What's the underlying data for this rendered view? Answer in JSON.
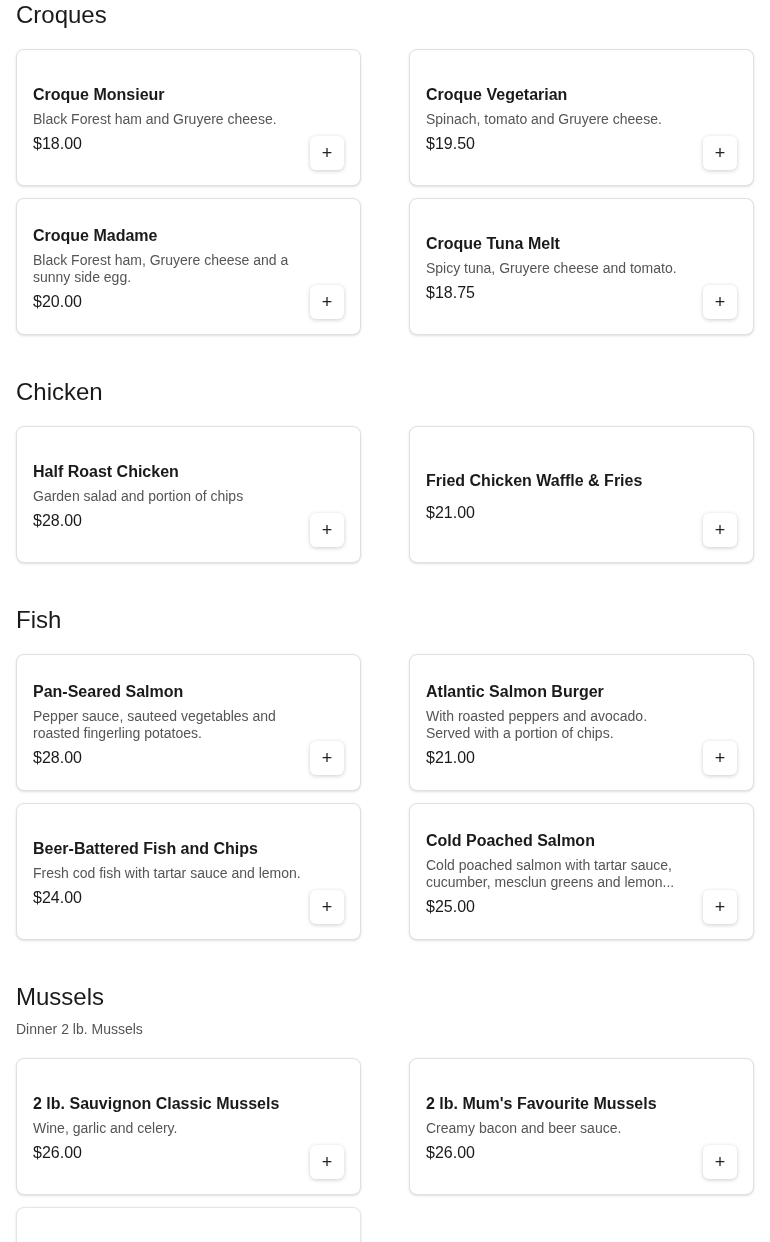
{
  "sections": [
    {
      "title": "Croques",
      "items": [
        {
          "name": "Croque Monsieur",
          "description": "Black Forest ham and Gruyere cheese.",
          "price": "$18.00",
          "button": "+"
        },
        {
          "name": "Croque Vegetarian",
          "description": "Spinach, tomato and Gruyere cheese.",
          "price": "$19.50",
          "button": "+"
        },
        {
          "name": "Croque Madame",
          "description": "Black Forest ham, Gruyere cheese and a sunny side egg.",
          "price": "$20.00",
          "button": "+"
        },
        {
          "name": "Croque Tuna Melt",
          "description": "Spicy tuna, Gruyere cheese and tomato.",
          "price": "$18.75",
          "button": "+"
        }
      ]
    },
    {
      "title": "Chicken",
      "items": [
        {
          "name": "Half Roast Chicken",
          "description": "Garden salad and portion of chips",
          "price": "$28.00",
          "button": "+"
        },
        {
          "name": "Fried Chicken Waffle & Fries",
          "price": "$21.00",
          "button": "+"
        }
      ]
    },
    {
      "title": "Fish",
      "items": [
        {
          "name": "Pan-Seared Salmon",
          "description": "Pepper sauce, sauteed vegetables and roasted fingerling potatoes.",
          "price": "$28.00",
          "button": "+"
        },
        {
          "name": "Atlantic Salmon Burger",
          "description": "With roasted peppers and avocado. Served with a portion of chips.",
          "price": "$21.00",
          "button": "+"
        },
        {
          "name": "Beer-Battered Fish and Chips",
          "description": "Fresh cod fish with tartar sauce and lemon.",
          "price": "$24.00",
          "button": "+"
        },
        {
          "name": "Cold Poached Salmon",
          "description": "Cold poached salmon with tartar sauce, cucumber, mesclun greens and lemon...",
          "price": "$25.00",
          "button": "+"
        }
      ]
    },
    {
      "title": "Mussels",
      "subtitle": "Dinner 2 lb. Mussels",
      "items": [
        {
          "name": "2 lb. Sauvignon Classic Mussels",
          "description": "Wine, garlic and celery.",
          "price": "$26.00",
          "button": "+"
        },
        {
          "name": "2 lb. Mum's Favourite Mussels",
          "description": "Creamy bacon and beer sauce.",
          "price": "$26.00",
          "button": "+"
        },
        {
          "kind": "faded"
        }
      ]
    }
  ]
}
